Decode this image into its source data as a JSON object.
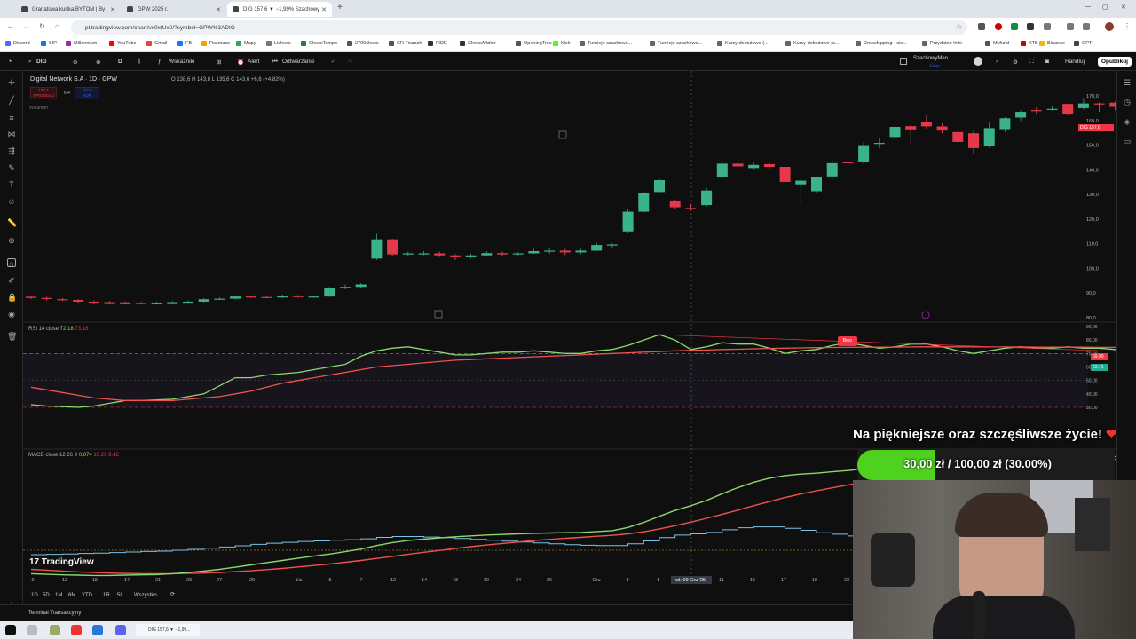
{
  "browser": {
    "tabs": [
      {
        "label": "Granatowa kurtka BYTOM | By"
      },
      {
        "label": "GPW 2025 r."
      },
      {
        "label": "DIG 157,6 ▼ −1,99% Szachowy"
      }
    ],
    "url": "pl.tradingview.com/chart/vx0xtUx0/?symbol=GPW%3ADIG",
    "bookmarks": [
      "Discord",
      "SIP",
      "Millennium",
      "YouTube",
      "Gmail",
      "FB",
      "Rozmacz",
      "Mapy",
      "Lichess",
      "ChessTempo",
      "2700chess",
      "CR Fiszach",
      "FIDE",
      "ChessArbiter",
      "OpeningTree",
      "Kick",
      "Turnieje szachowe...",
      "Turnieje szachowe...",
      "Kursy debiutowe (...",
      "Kursy debiutowe (s...",
      "Dropshipping - cie...",
      "Przydatne linki",
      "Myfund",
      "XTB",
      "Binance",
      "GPT"
    ],
    "bookmark_colors": [
      "#5865f2",
      "#1a73e8",
      "#9c27b0",
      "#ff0000",
      "#ea4335",
      "#1877f2",
      "#f4a300",
      "#34a853",
      "#777",
      "#2e7d32",
      "#555",
      "#555",
      "#333",
      "#333",
      "#555",
      "#53fc18",
      "#666",
      "#666",
      "#666",
      "#666",
      "#666",
      "#666",
      "#555",
      "#c00",
      "#f0b90b",
      "#444"
    ]
  },
  "toolbar": {
    "symbol": "DIG",
    "interval": "D",
    "indicators": "Wskaźniki",
    "alert": "Alert",
    "replay": "Odtwarzanie",
    "layout_name": "SzachowyMen...",
    "layout_sub": "Zapisz",
    "trade": "Handluj",
    "publish": "Opublikuj"
  },
  "legend": {
    "title": "Digital Network S.A · 1D · GPW",
    "ohlc": "O 138,6  H 143,8  L 135,6  C 143,6  +6,6 (+4,82%)",
    "sell_price": "157,2",
    "sell_label": "SPRZEDAJ",
    "spread": "6,4",
    "buy_price": "157,6",
    "buy_label": "KUP",
    "volume_label": "Wolumen"
  },
  "price_axis": {
    "ticks": [
      "170,0",
      "160,0",
      "150,0",
      "140,0",
      "130,0",
      "120,0",
      "110,0",
      "100,0",
      "90,0",
      "80,0"
    ],
    "current_symbol": "DIG",
    "current_price": "157,6"
  },
  "rsi": {
    "label": "RSI 14 close",
    "v1": "72,18",
    "v2": "73,18",
    "ticks": [
      "90,00",
      "80,00",
      "70,00",
      "60,00",
      "50,00",
      "40,00",
      "30,00"
    ],
    "badge1": "69,90",
    "badge2": "62,41",
    "bear_label": "Bear"
  },
  "macd": {
    "label": "MACD close 12 26 9",
    "v1": "0,874",
    "v2": "10,29",
    "v3": "9,42"
  },
  "time_axis": {
    "ticks": [
      "9",
      "13",
      "15",
      "17",
      "21",
      "23",
      "27",
      "29",
      "Lis",
      "5",
      "7",
      "12",
      "14",
      "18",
      "20",
      "24",
      "26",
      "Gru",
      "3",
      "5",
      "wt. 09 Gru '25",
      "11",
      "15",
      "17",
      "19",
      "23"
    ],
    "cursor_label": "wt. 09 Gru '25"
  },
  "ranges": [
    "1D",
    "5D",
    "1M",
    "6M",
    "YTD",
    "1R",
    "5L",
    "Wszystko"
  ],
  "brand": "TradingView",
  "terminal_label": "Terminal Transakcyjny",
  "taskbar_app": "DIG 157,6 ▼ −1,99...",
  "overlay": {
    "title": "Na piękniejsze oraz szczęśliwsze życie!",
    "goal_text": "30,00 zł / 100,00 zł (30.00%)",
    "goal_progress": 0.3
  },
  "chart_data": {
    "type": "candlestick",
    "symbol": "DIG",
    "ylim": [
      80,
      172
    ],
    "candles": [
      [
        88.5,
        88,
        89,
        87.5
      ],
      [
        88,
        87.6,
        88.5,
        87
      ],
      [
        87.5,
        87.2,
        88,
        86.8
      ],
      [
        87.2,
        86.5,
        87.5,
        86
      ],
      [
        86.5,
        86.3,
        87,
        85.8
      ],
      [
        86.3,
        86.2,
        86.8,
        85.8
      ],
      [
        86.2,
        86,
        86.6,
        85.7
      ],
      [
        86,
        85.9,
        86.4,
        85.6
      ],
      [
        85.9,
        86.1,
        86.5,
        85.6
      ],
      [
        86.1,
        86.3,
        86.7,
        85.9
      ],
      [
        86.3,
        86.5,
        87,
        86
      ],
      [
        86.5,
        87.5,
        88,
        86.2
      ],
      [
        87.5,
        87.7,
        88.2,
        87.2
      ],
      [
        87.7,
        88.6,
        89,
        87.4
      ],
      [
        88.6,
        88.4,
        89,
        88
      ],
      [
        88.4,
        88.2,
        88.8,
        87.9
      ],
      [
        88.2,
        88.8,
        89.4,
        87.9
      ],
      [
        88.8,
        88.4,
        89.2,
        88
      ],
      [
        88.4,
        88.6,
        89.1,
        88.1
      ],
      [
        88.6,
        92,
        92.5,
        88.4
      ],
      [
        92,
        92.5,
        93.5,
        91.5
      ],
      [
        92.5,
        93.5,
        94,
        92
      ],
      [
        104,
        111.8,
        114,
        103.5
      ],
      [
        111.8,
        105.7,
        112,
        105
      ],
      [
        105.7,
        106.1,
        106.8,
        105
      ],
      [
        106.1,
        106.1,
        107,
        105.4
      ],
      [
        106.1,
        105.3,
        106.8,
        104.6
      ],
      [
        105.3,
        104.5,
        105.8,
        103.4
      ],
      [
        104.5,
        105.3,
        106,
        104
      ],
      [
        105.3,
        106.2,
        107,
        105
      ],
      [
        106.2,
        105.7,
        106.8,
        105
      ],
      [
        105.7,
        106.1,
        106.6,
        105.3
      ],
      [
        106.1,
        107,
        107.9,
        105.9
      ],
      [
        107,
        107.2,
        108.3,
        106
      ],
      [
        107.2,
        106.5,
        107.9,
        105.4
      ],
      [
        106.5,
        107.2,
        108,
        105.8
      ],
      [
        107.2,
        109.5,
        110.5,
        107
      ],
      [
        109.5,
        109.7,
        110.2,
        108.4
      ],
      [
        115,
        123,
        124,
        114.5
      ],
      [
        123,
        130.5,
        131,
        122.7
      ],
      [
        131,
        135.8,
        136.5,
        130.6
      ],
      [
        127.3,
        124.8,
        128,
        123.9
      ],
      [
        124.5,
        124.4,
        126.1,
        123.4
      ],
      [
        125.7,
        131.6,
        132.7,
        125
      ],
      [
        137.1,
        142.5,
        143,
        136.7
      ],
      [
        142.5,
        141.4,
        143.3,
        140.3
      ],
      [
        140.7,
        142,
        143.2,
        140
      ],
      [
        142.3,
        141.2,
        142.9,
        140.2
      ],
      [
        141.2,
        135.1,
        141.9,
        133.9
      ],
      [
        134.1,
        135.6,
        136.5,
        126.2
      ],
      [
        131.3,
        136.9,
        137.3,
        130.4
      ],
      [
        137.3,
        142.7,
        143.8,
        135.6
      ],
      [
        143.1,
        143,
        143.4,
        142.6
      ],
      [
        143.2,
        150,
        151.2,
        142.3
      ],
      [
        150.9,
        150.9,
        152.8,
        148.8
      ],
      [
        153.3,
        157.4,
        158.4,
        151.7
      ],
      [
        157.7,
        156.4,
        158.3,
        150.1
      ],
      [
        159.3,
        157.6,
        162,
        156.6
      ],
      [
        157.6,
        155.9,
        158.8,
        154.8
      ],
      [
        155.3,
        151.3,
        156.8,
        150.1
      ],
      [
        154.8,
        148.8,
        156,
        146.4
      ],
      [
        149.6,
        156.9,
        159.3,
        149
      ],
      [
        156.5,
        160.9,
        161.4,
        155.3
      ],
      [
        161.2,
        163.5,
        164.1,
        159.8
      ],
      [
        164.2,
        164.1,
        165.3,
        162.8
      ],
      [
        164.3,
        164.7,
        165.9,
        164
      ],
      [
        166.7,
        162.8,
        166.7,
        162.1
      ],
      [
        165,
        166.9,
        169.1,
        164.4
      ],
      [
        166.9,
        166.8,
        167.2,
        163.5
      ],
      [
        167.2,
        165.5,
        167.6,
        164.1
      ],
      [
        166.9,
        161.6,
        167.2,
        160.1
      ],
      [
        164.1,
        165.5,
        166.5,
        160.1
      ],
      [
        164.5,
        162.2,
        164.9,
        158.6
      ],
      [
        161.5,
        158.8,
        164.4,
        157.7
      ]
    ],
    "rsi": [
      32,
      31,
      30.5,
      30,
      31,
      33,
      35,
      35,
      35.5,
      36,
      38,
      40,
      46,
      52,
      52,
      54,
      55,
      56,
      58,
      60,
      62,
      68,
      72,
      74,
      75,
      73,
      71,
      69,
      69,
      70,
      71,
      71,
      72,
      71,
      70,
      70,
      72,
      73,
      76,
      80,
      84,
      80,
      73,
      75,
      78,
      77,
      77,
      74,
      70,
      72,
      73,
      76,
      78,
      76,
      74,
      75,
      77,
      77,
      75,
      72,
      70,
      72,
      74,
      75,
      74,
      74,
      75,
      74,
      74,
      73,
      71,
      71,
      69,
      66
    ],
    "rsi_ma": [
      45,
      43,
      41,
      39,
      37,
      36,
      35,
      35,
      35,
      35,
      36,
      37,
      38,
      40,
      42,
      45,
      48,
      50,
      52,
      54,
      56,
      58,
      60,
      61,
      62,
      63,
      64,
      65,
      65.5,
      66,
      66.5,
      67,
      67.5,
      68,
      68.5,
      69,
      69.5,
      70,
      70.5,
      71,
      71.5,
      72,
      72.3,
      72.6,
      73,
      73.2,
      73.5,
      73.8,
      74,
      74.2,
      74.4,
      74.5,
      74.6,
      74.7,
      74.8,
      74.8,
      74.9,
      75,
      75,
      75,
      75,
      74.9,
      74.9,
      74.9,
      74.8,
      74.8,
      74.8,
      74.7,
      74.6,
      74.6,
      74.3,
      73.9,
      73.4,
      72.8
    ],
    "macd": [
      -8,
      -8.2,
      -8.4,
      -8.5,
      -8.6,
      -8.6,
      -8.5,
      -8.4,
      -8.3,
      -8,
      -7.6,
      -7.1,
      -6.5,
      -5.8,
      -5,
      -4.2,
      -3.5,
      -2.7,
      -2,
      -1.3,
      -0.5,
      0.4,
      1.6,
      2.6,
      3.3,
      3.8,
      4.2,
      4.6,
      4.9,
      5.2,
      5.4,
      5.6,
      5.8,
      5.9,
      6,
      6.1,
      6.4,
      6.7,
      7.8,
      9.5,
      11.6,
      13.6,
      15.2,
      17,
      19.3,
      21.4,
      23.2,
      24.6,
      25.5,
      26,
      26.3,
      26.8,
      27.2,
      27.8,
      28.5,
      29.3,
      30,
      30.5,
      31,
      31.3,
      31.5,
      31.8,
      32.1,
      32.4,
      32.6,
      32.6,
      32.5,
      32.4,
      32.2,
      32,
      31.8,
      31.6,
      31.5,
      31.4
    ],
    "signal": [
      -6.5,
      -6.8,
      -7.1,
      -7.4,
      -7.6,
      -7.8,
      -7.9,
      -8,
      -8,
      -8,
      -7.9,
      -7.8,
      -7.6,
      -7.3,
      -7,
      -6.6,
      -6.2,
      -5.7,
      -5.2,
      -4.7,
      -4.1,
      -3.5,
      -2.8,
      -2.1,
      -1.4,
      -0.7,
      -0.1,
      0.6,
      1.2,
      1.8,
      2.3,
      2.8,
      3.3,
      3.7,
      4.1,
      4.4,
      4.8,
      5.1,
      5.6,
      6.3,
      7.3,
      8.4,
      9.6,
      10.9,
      12.3,
      13.7,
      15.2,
      16.6,
      18,
      19.2,
      20.3,
      21.3,
      22.3,
      23.2,
      24,
      24.9,
      25.7,
      26.5,
      27.2,
      27.9,
      28.5,
      29,
      29.5,
      30,
      30.4,
      30.7,
      30.9,
      31,
      31,
      31,
      31,
      31,
      31,
      31
    ],
    "hist": [
      -1.5,
      -1.4,
      -1.3,
      -1.1,
      -1,
      -0.8,
      -0.6,
      -0.4,
      -0.3,
      0,
      0.3,
      0.7,
      1.1,
      1.5,
      2,
      2.4,
      2.7,
      3,
      3.2,
      3.4,
      3.6,
      3.9,
      4.4,
      4.7,
      4.7,
      4.5,
      4.3,
      4,
      3.7,
      3.4,
      3.1,
      2.8,
      2.5,
      2.2,
      1.9,
      1.7,
      1.6,
      1.6,
      2.2,
      3.2,
      4.3,
      5.2,
      5.6,
      6.1,
      7,
      7.7,
      8,
      8,
      7.5,
      6.8,
      6,
      5.5,
      4.9,
      4.6,
      4.5,
      4.4,
      4.3,
      4,
      3.8,
      3.4,
      3,
      2.8,
      2.6,
      2.4,
      2.2,
      1.9,
      1.6,
      1.4,
      1.2,
      1,
      0.8,
      0.6,
      0.5,
      0.4
    ]
  }
}
